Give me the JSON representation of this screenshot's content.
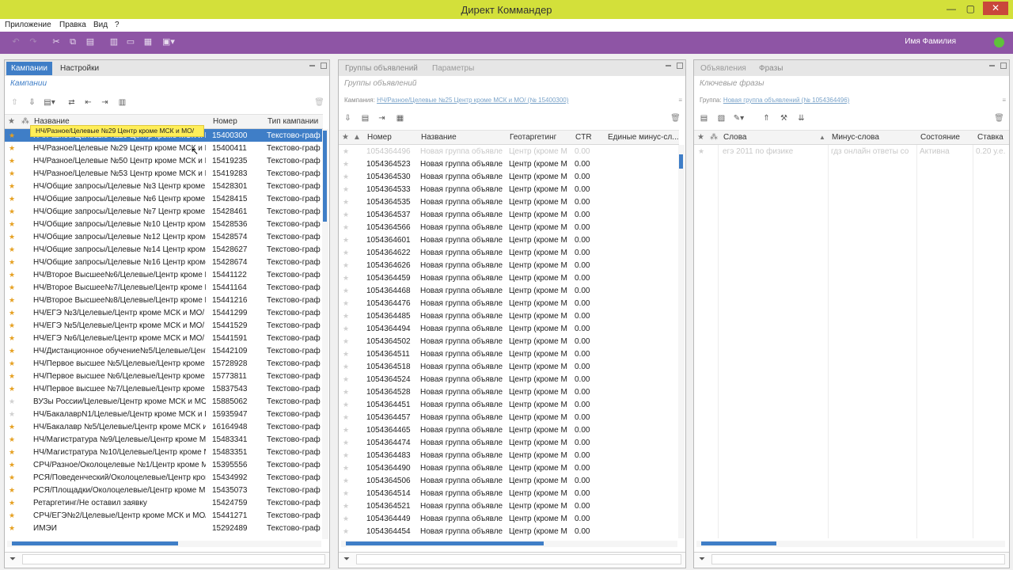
{
  "window": {
    "title": "Директ Коммандер"
  },
  "menu": {
    "items": [
      "Приложение",
      "Правка",
      "Вид",
      "?"
    ]
  },
  "toolbar": {
    "user_name": "Имя Фамилия"
  },
  "left_panel": {
    "tabs": [
      "Кампании",
      "Настройки"
    ],
    "subtitle": "Кампании",
    "columns": [
      "Название",
      "Номер",
      "Тип кампании"
    ],
    "tooltip": "НЧ/Разное/Целевые №29 Центр кроме МСК и МО/",
    "rows": [
      {
        "name": "НЧ/Разное/Целевые №29 Центр кроме МСК и МО/",
        "num": "15400300",
        "type": "Текстово-граф"
      },
      {
        "name": "НЧ/Разное/Целевые №29 Центр кроме МСК и МО/",
        "num": "15400411",
        "type": "Текстово-граф"
      },
      {
        "name": "НЧ/Разное/Целевые №50 Центр кроме МСК и МО/",
        "num": "15419235",
        "type": "Текстово-граф"
      },
      {
        "name": "НЧ/Разное/Целевые №53 Центр кроме МСК и МО/",
        "num": "15419283",
        "type": "Текстово-граф"
      },
      {
        "name": "НЧ/Общие запросы/Целевые №3 Центр кроме МСК",
        "num": "15428301",
        "type": "Текстово-граф"
      },
      {
        "name": "НЧ/Общие запросы/Целевые №6 Центр кроме МСК",
        "num": "15428415",
        "type": "Текстово-граф"
      },
      {
        "name": "НЧ/Общие запросы/Целевые №7 Центр кроме МСК",
        "num": "15428461",
        "type": "Текстово-граф"
      },
      {
        "name": "НЧ/Общие запросы/Целевые №10 Центр кроме МСК",
        "num": "15428536",
        "type": "Текстово-граф"
      },
      {
        "name": "НЧ/Общие запросы/Целевые №12 Центр кроме МСК",
        "num": "15428574",
        "type": "Текстово-граф"
      },
      {
        "name": "НЧ/Общие запросы/Целевые №14 Центр кроме МСК",
        "num": "15428627",
        "type": "Текстово-граф"
      },
      {
        "name": "НЧ/Общие запросы/Целевые №16 Центр кроме МСК",
        "num": "15428674",
        "type": "Текстово-граф"
      },
      {
        "name": "НЧ/Второе Высшее№6/Целевые/Центр кроме МСК",
        "num": "15441122",
        "type": "Текстово-граф"
      },
      {
        "name": "НЧ/Второе Высшее№7/Целевые/Центр кроме МСК",
        "num": "15441164",
        "type": "Текстово-граф"
      },
      {
        "name": "НЧ/Второе Высшее№8/Целевые/Центр кроме МСК",
        "num": "15441216",
        "type": "Текстово-граф"
      },
      {
        "name": "НЧ/ЕГЭ №3/Целевые/Центр кроме МСК и МО/",
        "num": "15441299",
        "type": "Текстово-граф"
      },
      {
        "name": "НЧ/ЕГЭ №5/Целевые/Центр кроме МСК и МО/",
        "num": "15441529",
        "type": "Текстово-граф"
      },
      {
        "name": "НЧ/ЕГЭ №6/Целевые/Центр кроме МСК и МО/",
        "num": "15441591",
        "type": "Текстово-граф"
      },
      {
        "name": "НЧ/Дистанционное обучение№5/Целевые/Центр",
        "num": "15442109",
        "type": "Текстово-граф"
      },
      {
        "name": "НЧ/Первое высшее №5/Целевые/Центр кроме МСК",
        "num": "15728928",
        "type": "Текстово-граф"
      },
      {
        "name": "НЧ/Первое высшее №6/Целевые/Центр кроме МСК",
        "num": "15773811",
        "type": "Текстово-граф"
      },
      {
        "name": "НЧ/Первое высшее №7/Целевые/Центр кроме МСК",
        "num": "15837543",
        "type": "Текстово-граф"
      },
      {
        "name": "ВУЗы России/Целевые/Центр кроме МСК и МО/",
        "num": "15885062",
        "type": "Текстово-граф"
      },
      {
        "name": "НЧ/БакалаврN1/Целевые/Центр кроме МСК и МО/",
        "num": "15935947",
        "type": "Текстово-граф"
      },
      {
        "name": "НЧ/Бакалавр №5/Целевые/Центр кроме МСК и МО/",
        "num": "16164948",
        "type": "Текстово-граф"
      },
      {
        "name": "НЧ/Магистратура №9/Целевые/Центр кроме МСК",
        "num": "15483341",
        "type": "Текстово-граф"
      },
      {
        "name": "НЧ/Магистратура №10/Целевые/Центр кроме МСК",
        "num": "15483351",
        "type": "Текстово-граф"
      },
      {
        "name": "СРЧ/Разное/Околоцелевые №1/Центр кроме МСК",
        "num": "15395556",
        "type": "Текстово-граф"
      },
      {
        "name": "РСЯ/Поведенческий/Околоцелевые/Центр кроме",
        "num": "15434992",
        "type": "Текстово-граф"
      },
      {
        "name": "РСЯ/Площадки/Околоцелевые/Центр кроме МСК",
        "num": "15435073",
        "type": "Текстово-граф"
      },
      {
        "name": "Ретаргетинг/Не оставил заявку",
        "num": "15424759",
        "type": "Текстово-граф"
      },
      {
        "name": "СРЧ/ЕГЭ№2/Целевые/Центр кроме МСК и МО/",
        "num": "15441271",
        "type": "Текстово-граф"
      },
      {
        "name": "ИМЭИ",
        "num": "15292489",
        "type": "Текстово-граф"
      }
    ]
  },
  "mid_panel": {
    "tabs": [
      "Группы объявлений",
      "Параметры"
    ],
    "subtitle": "Группы объявлений",
    "crumb_label": "Кампания:",
    "crumb_link": "НЧ/Разное/Целевые №25 Центр кроме МСК и МО/ (№ 15400300)",
    "columns": [
      "Номер",
      "Название",
      "Геотаргетинг",
      "CTR",
      "Единые минус-сл..."
    ],
    "rows": [
      {
        "num": "1054364496",
        "name": "Новая группа объявле",
        "geo": "Центр (кроме М",
        "ctr": "0.00"
      },
      {
        "num": "1054364523",
        "name": "Новая группа объявле",
        "geo": "Центр (кроме М",
        "ctr": "0.00"
      },
      {
        "num": "1054364530",
        "name": "Новая группа объявле",
        "geo": "Центр (кроме М",
        "ctr": "0.00"
      },
      {
        "num": "1054364533",
        "name": "Новая группа объявле",
        "geo": "Центр (кроме М",
        "ctr": "0.00"
      },
      {
        "num": "1054364535",
        "name": "Новая группа объявле",
        "geo": "Центр (кроме М",
        "ctr": "0.00"
      },
      {
        "num": "1054364537",
        "name": "Новая группа объявле",
        "geo": "Центр (кроме М",
        "ctr": "0.00"
      },
      {
        "num": "1054364566",
        "name": "Новая группа объявле",
        "geo": "Центр (кроме М",
        "ctr": "0.00"
      },
      {
        "num": "1054364601",
        "name": "Новая группа объявле",
        "geo": "Центр (кроме М",
        "ctr": "0.00"
      },
      {
        "num": "1054364622",
        "name": "Новая группа объявле",
        "geo": "Центр (кроме М",
        "ctr": "0.00"
      },
      {
        "num": "1054364626",
        "name": "Новая группа объявле",
        "geo": "Центр (кроме М",
        "ctr": "0.00"
      },
      {
        "num": "1054364459",
        "name": "Новая группа объявле",
        "geo": "Центр (кроме М",
        "ctr": "0.00"
      },
      {
        "num": "1054364468",
        "name": "Новая группа объявле",
        "geo": "Центр (кроме М",
        "ctr": "0.00"
      },
      {
        "num": "1054364476",
        "name": "Новая группа объявле",
        "geo": "Центр (кроме М",
        "ctr": "0.00"
      },
      {
        "num": "1054364485",
        "name": "Новая группа объявле",
        "geo": "Центр (кроме М",
        "ctr": "0.00"
      },
      {
        "num": "1054364494",
        "name": "Новая группа объявле",
        "geo": "Центр (кроме М",
        "ctr": "0.00"
      },
      {
        "num": "1054364502",
        "name": "Новая группа объявле",
        "geo": "Центр (кроме М",
        "ctr": "0.00"
      },
      {
        "num": "1054364511",
        "name": "Новая группа объявле",
        "geo": "Центр (кроме М",
        "ctr": "0.00"
      },
      {
        "num": "1054364518",
        "name": "Новая группа объявле",
        "geo": "Центр (кроме М",
        "ctr": "0.00"
      },
      {
        "num": "1054364524",
        "name": "Новая группа объявле",
        "geo": "Центр (кроме М",
        "ctr": "0.00"
      },
      {
        "num": "1054364528",
        "name": "Новая группа объявле",
        "geo": "Центр (кроме М",
        "ctr": "0.00"
      },
      {
        "num": "1054364451",
        "name": "Новая группа объявле",
        "geo": "Центр (кроме М",
        "ctr": "0.00"
      },
      {
        "num": "1054364457",
        "name": "Новая группа объявле",
        "geo": "Центр (кроме М",
        "ctr": "0.00"
      },
      {
        "num": "1054364465",
        "name": "Новая группа объявле",
        "geo": "Центр (кроме М",
        "ctr": "0.00"
      },
      {
        "num": "1054364474",
        "name": "Новая группа объявле",
        "geo": "Центр (кроме М",
        "ctr": "0.00"
      },
      {
        "num": "1054364483",
        "name": "Новая группа объявле",
        "geo": "Центр (кроме М",
        "ctr": "0.00"
      },
      {
        "num": "1054364490",
        "name": "Новая группа объявле",
        "geo": "Центр (кроме М",
        "ctr": "0.00"
      },
      {
        "num": "1054364506",
        "name": "Новая группа объявле",
        "geo": "Центр (кроме М",
        "ctr": "0.00"
      },
      {
        "num": "1054364514",
        "name": "Новая группа объявле",
        "geo": "Центр (кроме М",
        "ctr": "0.00"
      },
      {
        "num": "1054364521",
        "name": "Новая группа объявле",
        "geo": "Центр (кроме М",
        "ctr": "0.00"
      },
      {
        "num": "1054364449",
        "name": "Новая группа объявле",
        "geo": "Центр (кроме М",
        "ctr": "0.00"
      },
      {
        "num": "1054364454",
        "name": "Новая группа объявле",
        "geo": "Центр (кроме М",
        "ctr": "0.00"
      }
    ]
  },
  "right_panel": {
    "tabs": [
      "Объявления",
      "Фразы"
    ],
    "subtitle": "Ключевые фразы",
    "crumb_label": "Группа:",
    "crumb_link": "Новая группа объявлений (№ 1054364496)",
    "columns": [
      "Слова",
      "Минус-слова",
      "Состояние",
      "Ставка"
    ],
    "rows": [
      {
        "words": "егэ 2011 по физике",
        "minus": "гдз онлайн ответы со",
        "state": "Активна",
        "bid": "0.20 у.е."
      }
    ]
  }
}
